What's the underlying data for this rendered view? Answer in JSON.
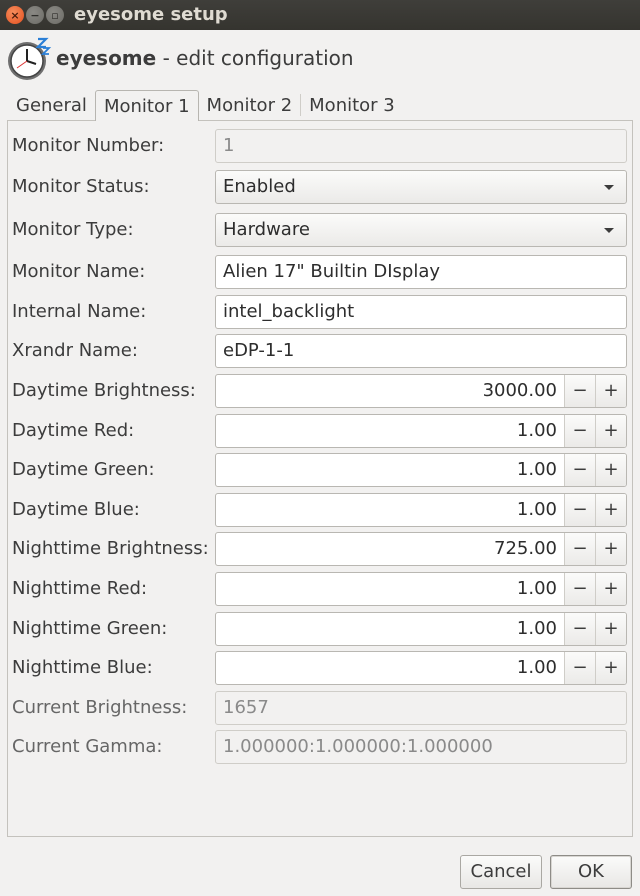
{
  "window": {
    "title": "eyesome setup",
    "close_glyph": "×",
    "minimize_glyph": "−",
    "maximize_glyph": "▫"
  },
  "header": {
    "app_name": "eyesome",
    "subtitle": " - edit configuration",
    "icon": "clock-zz-icon"
  },
  "tabs": [
    {
      "label": "General",
      "active": false
    },
    {
      "label": "Monitor 1",
      "active": true
    },
    {
      "label": "Monitor 2",
      "active": false
    },
    {
      "label": "Monitor 3",
      "active": false
    }
  ],
  "form": {
    "monitor_number": {
      "label": "Monitor Number:",
      "value": "1"
    },
    "monitor_status": {
      "label": "Monitor Status:",
      "value": "Enabled"
    },
    "monitor_type": {
      "label": "Monitor Type:",
      "value": "Hardware"
    },
    "monitor_name": {
      "label": "Monitor Name:",
      "value": "Alien 17\" Builtin DIsplay"
    },
    "internal_name": {
      "label": "Internal Name:",
      "value": "intel_backlight"
    },
    "xrandr_name": {
      "label": "Xrandr Name:",
      "value": "eDP-1-1"
    },
    "daytime_brightness": {
      "label": "Daytime Brightness:",
      "value": "3000.00"
    },
    "daytime_red": {
      "label": "Daytime Red:",
      "value": "1.00"
    },
    "daytime_green": {
      "label": "Daytime Green:",
      "value": "1.00"
    },
    "daytime_blue": {
      "label": "Daytime Blue:",
      "value": "1.00"
    },
    "nighttime_brightness": {
      "label": "Nighttime Brightness:",
      "value": "725.00"
    },
    "nighttime_red": {
      "label": "Nighttime Red:",
      "value": "1.00"
    },
    "nighttime_green": {
      "label": "Nighttime Green:",
      "value": "1.00"
    },
    "nighttime_blue": {
      "label": "Nighttime Blue:",
      "value": "1.00"
    },
    "current_brightness": {
      "label": "Current Brightness:",
      "value": "1657"
    },
    "current_gamma": {
      "label": "Current Gamma:",
      "value": "1.000000:1.000000:1.000000"
    }
  },
  "spin": {
    "minus": "−",
    "plus": "+"
  },
  "buttons": {
    "cancel": "Cancel",
    "ok": "OK"
  }
}
